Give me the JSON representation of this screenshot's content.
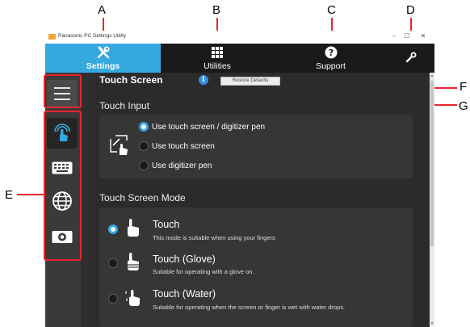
{
  "callouts": {
    "a": "A",
    "b": "B",
    "c": "C",
    "d": "D",
    "e": "E",
    "f": "F",
    "g": "G"
  },
  "window": {
    "title": "Panasonic PC Settings Utility",
    "controls": {
      "minimize": "–",
      "maximize": "☐",
      "close": "✕"
    }
  },
  "tabs": [
    {
      "label": "Settings",
      "icon": "wrench-screwdriver-icon",
      "active": true
    },
    {
      "label": "Utilities",
      "icon": "grid-icon",
      "active": false
    },
    {
      "label": "Support",
      "icon": "question-icon",
      "active": false
    },
    {
      "label": "",
      "icon": "wrench-icon",
      "active": false
    }
  ],
  "sidebar": {
    "menu_icon": "hamburger-menu-icon",
    "items": [
      {
        "icon": "touch-icon",
        "active": true
      },
      {
        "icon": "keyboard-icon",
        "active": false
      },
      {
        "icon": "globe-icon",
        "active": false
      },
      {
        "icon": "camera-icon",
        "active": false
      }
    ]
  },
  "page": {
    "title": "Touch Screen",
    "info_icon": "i",
    "restore_button": "Restore Defaults"
  },
  "touch_input": {
    "title": "Touch Input",
    "options": [
      {
        "label": "Use touch screen / digitizer pen",
        "selected": true
      },
      {
        "label": "Use touch screen",
        "selected": false
      },
      {
        "label": "Use digitizer pen",
        "selected": false
      }
    ]
  },
  "touch_mode": {
    "title": "Touch Screen Mode",
    "modes": [
      {
        "title": "Touch",
        "description": "This mode is suitable when using your fingers",
        "selected": true
      },
      {
        "title": "Touch (Glove)",
        "description": "Suitable for operating with a glove on.",
        "selected": false
      },
      {
        "title": "Touch (Water)",
        "description": "Suitable for operating when the screen or finger is wet with water drops.",
        "selected": false
      }
    ]
  },
  "colors": {
    "accent": "#35a8e0",
    "callout": "#e8242c",
    "window_bg": "#2b2b2b",
    "tabbar_bg": "#1a1a1a"
  }
}
